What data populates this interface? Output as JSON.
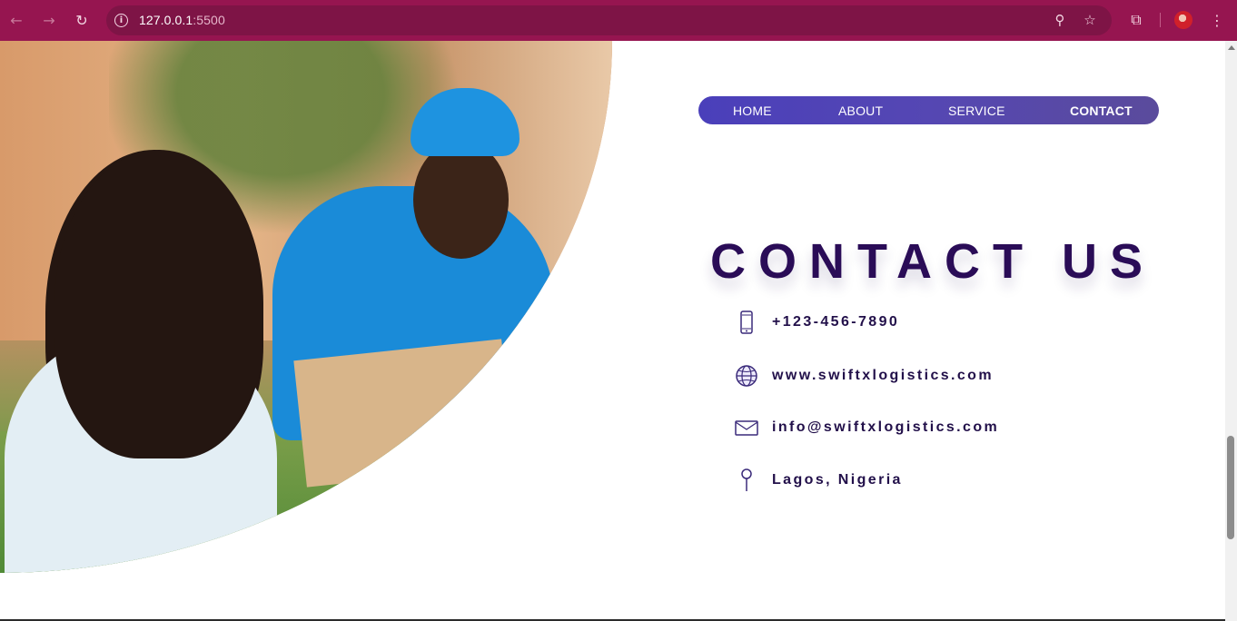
{
  "browser": {
    "back_icon": "arrow-left-icon",
    "forward_icon": "arrow-right-icon",
    "reload_icon": "reload-icon",
    "url_host": "127.0.0.1",
    "url_port": ":5500",
    "colors": {
      "chrome": "#961550",
      "omnibox": "#7e1446"
    }
  },
  "nav": {
    "items": [
      {
        "label": "HOME",
        "active": false
      },
      {
        "label": "ABOUT",
        "active": false
      },
      {
        "label": "SERVICE",
        "active": false
      },
      {
        "label": "CONTACT",
        "active": true
      }
    ],
    "colors": {
      "gradient_start": "#4a3fba",
      "gradient_end": "#5a4b9c"
    }
  },
  "hero": {
    "image": "delivery-man-with-customer-photo"
  },
  "contact": {
    "title": "CONTACT US",
    "items": [
      {
        "icon": "phone-icon",
        "text": "+123-456-7890"
      },
      {
        "icon": "globe-icon",
        "text": "www.swiftxlogistics.com"
      },
      {
        "icon": "mail-icon",
        "text": "info@swiftxlogistics.com"
      },
      {
        "icon": "location-pin-icon",
        "text": "Lagos, Nigeria"
      }
    ],
    "colors": {
      "title": "#2a0c57",
      "text": "#22104a"
    }
  }
}
